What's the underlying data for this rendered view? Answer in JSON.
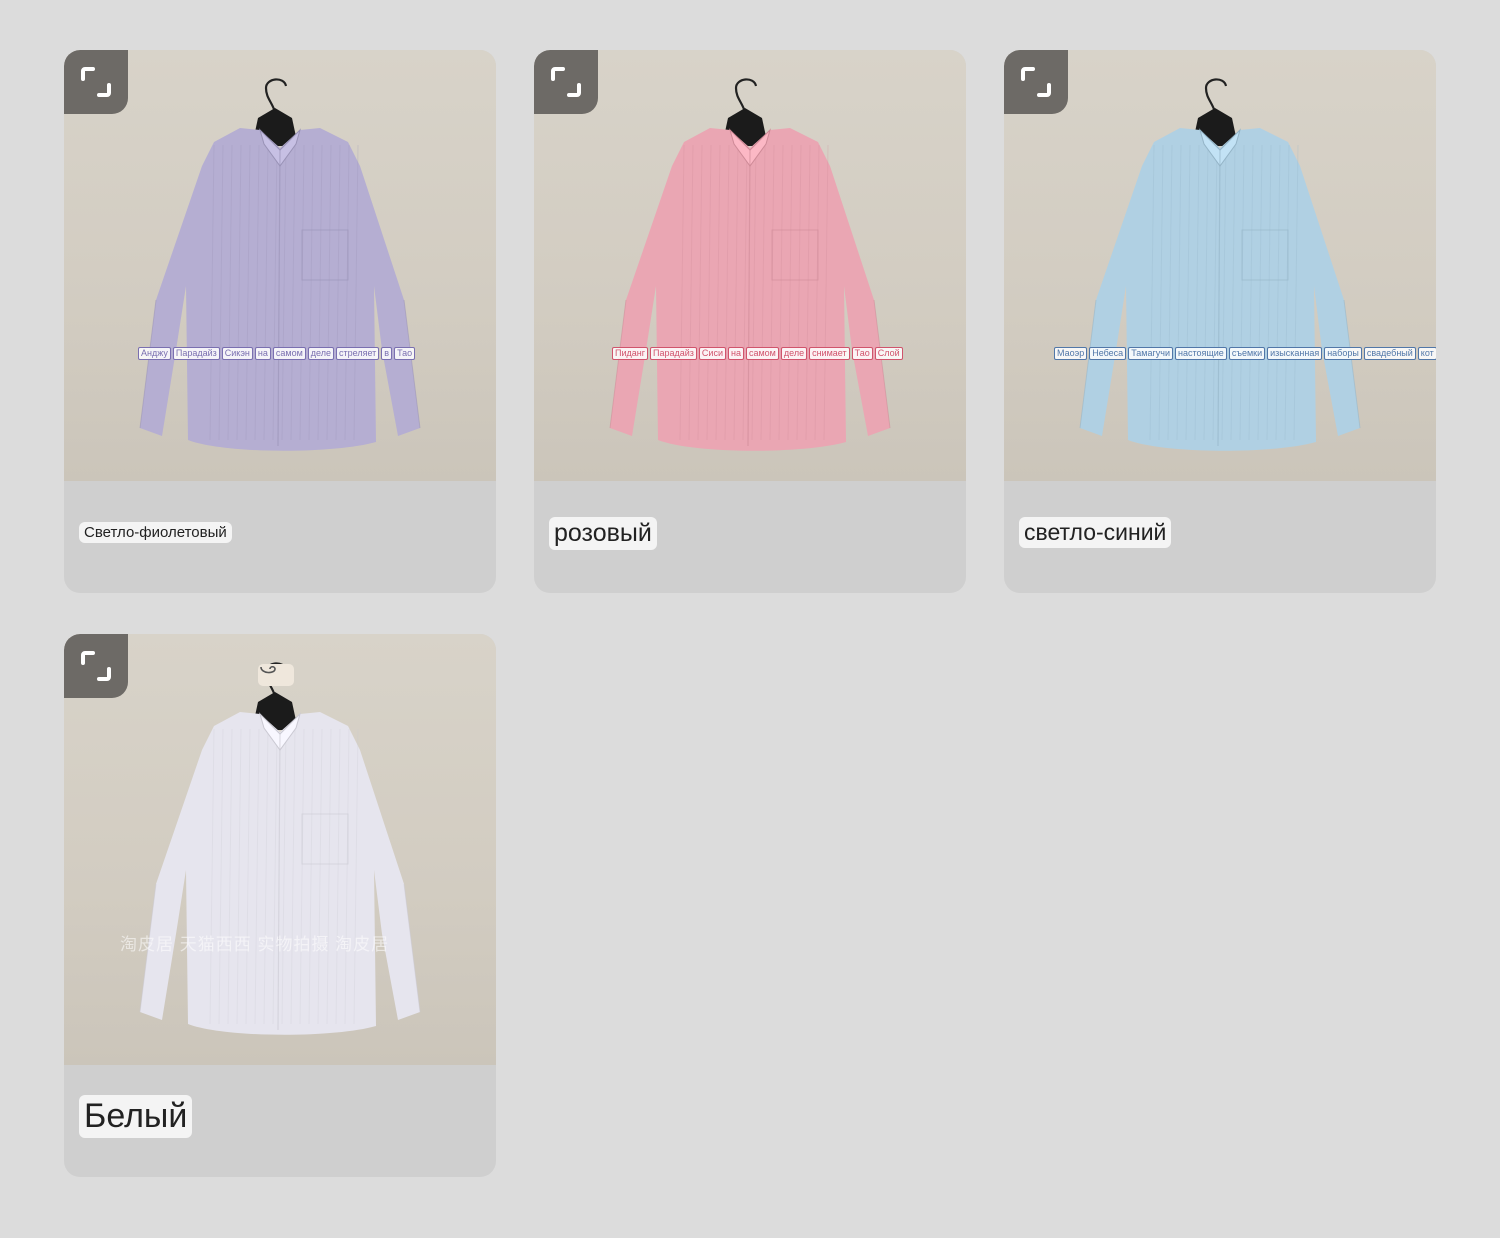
{
  "colors": {
    "page_bg": "#dcdcdc",
    "card_bg": "#cfcfcf",
    "expand_bg": "#6d6a66",
    "label_bg": "#f4f4f4"
  },
  "cards": [
    {
      "label": "Светло-фиолетовый",
      "shirt_color": "#b5aed2",
      "overlay": [
        "Анджу",
        "Парадайз",
        "Сикэн",
        "на",
        "самом",
        "деле",
        "стреляет",
        "в",
        "Тао"
      ],
      "overlay_color": "#7a6fb0",
      "icons": [
        "expand-icon"
      ]
    },
    {
      "label": "розовый",
      "shirt_color": "#eaa6b3",
      "overlay": [
        "Пиданг",
        "Парадайз",
        "Сиси",
        "на",
        "самом",
        "деле",
        "снимает",
        "Тао",
        "Слой"
      ],
      "overlay_color": "#d0546c",
      "icons": [
        "expand-icon"
      ]
    },
    {
      "label": "светло-синий",
      "shirt_color": "#b0d0e3",
      "overlay": [
        "Маоэр",
        "Небеса",
        "Тамагучи",
        "настоящие",
        "съемки",
        "изысканная",
        "наборы",
        "свадебный",
        "кот"
      ],
      "overlay_color": "#5177a8",
      "icons": [
        "expand-icon"
      ]
    },
    {
      "label": "Белый",
      "shirt_color": "#e6e5ee",
      "watermark": "淘皮居 天猫西西 实物拍摄 淘皮居",
      "icons": [
        "expand-icon",
        "hook-icon"
      ]
    }
  ]
}
